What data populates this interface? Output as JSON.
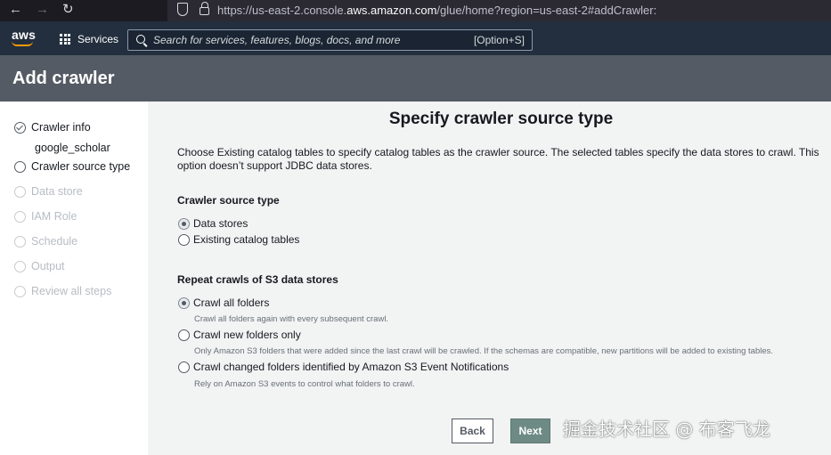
{
  "browser": {
    "url_prefix": "https://us-east-2.console.",
    "url_domain": "aws.amazon.com",
    "url_path": "/glue/home?region=us-east-2#addCrawler:"
  },
  "header": {
    "logo_text": "aws",
    "services_label": "Services",
    "search_placeholder": "Search for services, features, blogs, docs, and more",
    "search_shortcut": "[Option+S]",
    "brand_color": "#ff9900"
  },
  "page": {
    "title": "Add crawler"
  },
  "sidebar": {
    "steps": [
      {
        "label": "Crawler info",
        "state": "done",
        "sub": "google_scholar"
      },
      {
        "label": "Crawler source type",
        "state": "active"
      },
      {
        "label": "Data store",
        "state": "disabled"
      },
      {
        "label": "IAM Role",
        "state": "disabled"
      },
      {
        "label": "Schedule",
        "state": "disabled"
      },
      {
        "label": "Output",
        "state": "disabled"
      },
      {
        "label": "Review all steps",
        "state": "disabled"
      }
    ]
  },
  "main": {
    "heading": "Specify crawler source type",
    "description": "Choose Existing catalog tables to specify catalog tables as the crawler source. The selected tables specify the data stores to crawl. This option doesn’t support JDBC data stores.",
    "source_type": {
      "label": "Crawler source type",
      "options": [
        {
          "label": "Data stores",
          "checked": true
        },
        {
          "label": "Existing catalog tables",
          "checked": false
        }
      ]
    },
    "repeat_crawls": {
      "label": "Repeat crawls of S3 data stores",
      "options": [
        {
          "label": "Crawl all folders",
          "hint": "Crawl all folders again with every subsequent crawl.",
          "checked": true
        },
        {
          "label": "Crawl new folders only",
          "hint": "Only Amazon S3 folders that were added since the last crawl will be crawled. If the schemas are compatible, new partitions will be added to existing tables.",
          "checked": false
        },
        {
          "label": "Crawl changed folders identified by Amazon S3 Event Notifications",
          "hint": "Rely on Amazon S3 events to control what folders to crawl.",
          "checked": false
        }
      ]
    },
    "back_label": "Back",
    "next_label": "Next"
  },
  "watermark": "掘金技术社区 @ 布客飞龙"
}
